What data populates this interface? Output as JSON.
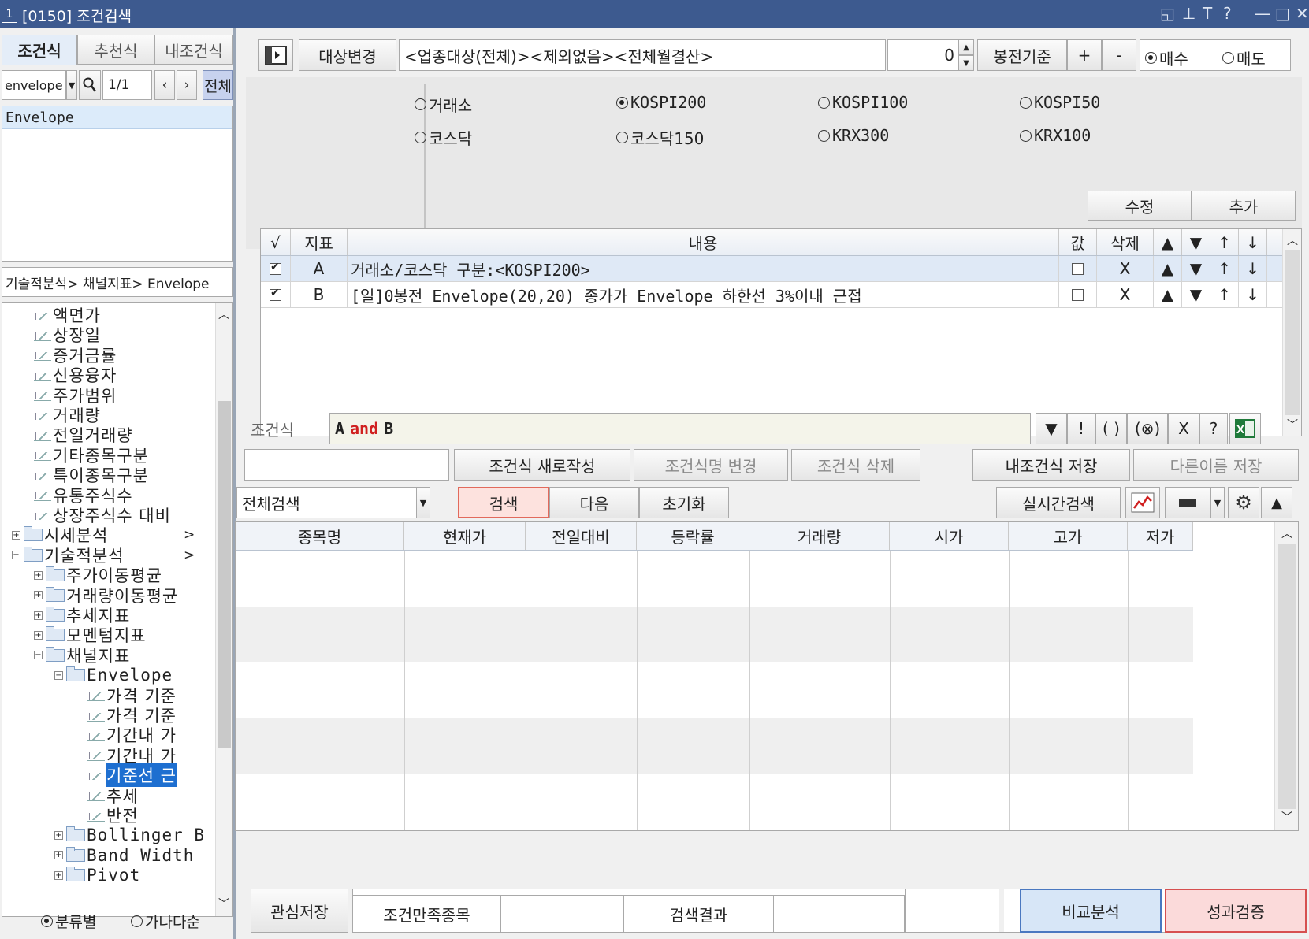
{
  "window": {
    "number": "1",
    "title": "[0150] 조건검색"
  },
  "left": {
    "tabs": [
      "조건식",
      "추천식",
      "내조건식"
    ],
    "search": {
      "value": "envelope",
      "page": "1/1",
      "all_label": "전체"
    },
    "result_item": "Envelope",
    "breadcrumb": "기술적분석> 채널지표> Envelope",
    "tree": [
      {
        "label": "액면가",
        "type": "leaf",
        "level": 2
      },
      {
        "label": "상장일",
        "type": "leaf",
        "level": 2
      },
      {
        "label": "증거금률",
        "type": "leaf",
        "level": 2
      },
      {
        "label": "신용융자",
        "type": "leaf",
        "level": 2
      },
      {
        "label": "주가범위",
        "type": "leaf",
        "level": 2
      },
      {
        "label": "거래량",
        "type": "leaf",
        "level": 2
      },
      {
        "label": "전일거래량",
        "type": "leaf",
        "level": 2
      },
      {
        "label": "기타종목구분",
        "type": "leaf",
        "level": 2
      },
      {
        "label": "특이종목구분",
        "type": "leaf",
        "level": 2
      },
      {
        "label": "유통주식수",
        "type": "leaf",
        "level": 2
      },
      {
        "label": "상장주식수 대비",
        "type": "leaf",
        "level": 2
      },
      {
        "label": "시세분석",
        "type": "folder",
        "level": 1,
        "expander": "+",
        "arrow": ">"
      },
      {
        "label": "기술적분석",
        "type": "folder",
        "level": 1,
        "expander": "-",
        "arrow": ">"
      },
      {
        "label": "주가이동평균",
        "type": "folder",
        "level": 2,
        "expander": "+"
      },
      {
        "label": "거래량이동평균",
        "type": "folder",
        "level": 2,
        "expander": "+"
      },
      {
        "label": "추세지표",
        "type": "folder",
        "level": 2,
        "expander": "+"
      },
      {
        "label": "모멘텀지표",
        "type": "folder",
        "level": 2,
        "expander": "+"
      },
      {
        "label": "채널지표",
        "type": "folder",
        "level": 2,
        "expander": "-"
      },
      {
        "label": "Envelope",
        "type": "folder",
        "level": 3,
        "expander": "-"
      },
      {
        "label": "가격 기준",
        "type": "leaf",
        "level": 4
      },
      {
        "label": "가격 기준",
        "type": "leaf",
        "level": 4
      },
      {
        "label": "기간내 가",
        "type": "leaf",
        "level": 4
      },
      {
        "label": "기간내 가",
        "type": "leaf",
        "level": 4
      },
      {
        "label": "기준선 근",
        "type": "leaf",
        "level": 4,
        "selected": true
      },
      {
        "label": "추세",
        "type": "leaf",
        "level": 4
      },
      {
        "label": "반전",
        "type": "leaf",
        "level": 4
      },
      {
        "label": "Bollinger B",
        "type": "folder",
        "level": 3,
        "expander": "+"
      },
      {
        "label": "Band Width",
        "type": "folder",
        "level": 3,
        "expander": "+"
      },
      {
        "label": "Pivot",
        "type": "folder",
        "level": 3,
        "expander": "+"
      }
    ],
    "sort": {
      "by_category": "분류별",
      "by_alpha": "가나다순"
    }
  },
  "top": {
    "target_change": "대상변경",
    "target_text": "<업종대상(전체)><제외없음><전체월결산>",
    "bar_value": "0",
    "bar_label": "봉전기준",
    "plus": "+",
    "minus": "-",
    "buy": "매수",
    "sell": "매도"
  },
  "markets": [
    {
      "label": "거래소",
      "selected": false
    },
    {
      "label": "KOSPI200",
      "selected": true
    },
    {
      "label": "KOSPI100",
      "selected": false
    },
    {
      "label": "KOSPI50",
      "selected": false
    },
    {
      "label": "코스닥",
      "selected": false
    },
    {
      "label": "코스닥150",
      "selected": false
    },
    {
      "label": "KRX300",
      "selected": false
    },
    {
      "label": "KRX100",
      "selected": false
    }
  ],
  "edit_buttons": {
    "modify": "수정",
    "add": "추가"
  },
  "cond_table": {
    "headers": [
      "√",
      "지표",
      "내용",
      "값",
      "삭제",
      "▲",
      "▼",
      "↑",
      "↓"
    ],
    "rows": [
      {
        "id": "A",
        "content": "거래소/코스닥 구분:<KOSPI200>",
        "checked": true,
        "value_checked": false,
        "del": "X"
      },
      {
        "id": "B",
        "content": "[일]0봉전 Envelope(20,20) 종가가 Envelope 하한선 3%이내 근접",
        "checked": true,
        "value_checked": false,
        "del": "X"
      }
    ]
  },
  "expr": {
    "label": "조건식",
    "a": "A",
    "op": "and",
    "b": "B",
    "tools": [
      "▼",
      "!",
      "( )",
      "(⊗)",
      "X",
      "?"
    ]
  },
  "actions": {
    "new": "조건식 새로작성",
    "rename": "조건식명 변경",
    "delete": "조건식 삭제",
    "save": "내조건식 저장",
    "save_as": "다른이름 저장"
  },
  "search_bar": {
    "scope": "전체검색",
    "search": "검색",
    "next": "다음",
    "reset": "초기화",
    "realtime": "실시간검색"
  },
  "results": {
    "headers": [
      "종목명",
      "현재가",
      "전일대비",
      "등락률",
      "거래량",
      "시가",
      "고가",
      "저가"
    ],
    "rows": []
  },
  "bottom": {
    "save_watch": "관심저장",
    "matched": "조건만족종목",
    "search_result": "검색결과",
    "compare": "비교분석",
    "verify": "성과검증"
  },
  "colors": {
    "title_bar": "#3d5a8f",
    "search_button": "#fde2de",
    "compare": "#d7e6f7",
    "verify": "#fbdada",
    "selected": "#1e6fd0",
    "and_op": "#d02020"
  }
}
